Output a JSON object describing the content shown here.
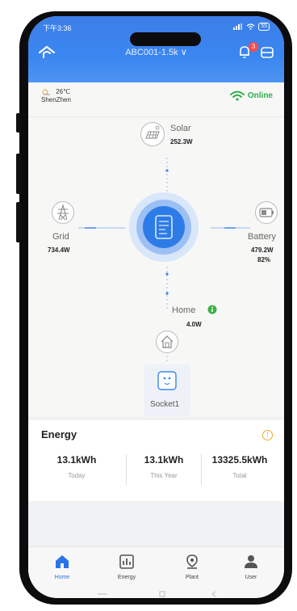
{
  "status_bar": {
    "time": "下午3:36",
    "battery": "55"
  },
  "header": {
    "title": "ABC001-1.5k ∨",
    "notification_count": "3"
  },
  "weather": {
    "temperature": "26℃",
    "city": "ShenZhen"
  },
  "connection": {
    "status": "Online"
  },
  "flow": {
    "solar": {
      "label": "Solar",
      "value": "252.3W"
    },
    "grid": {
      "label": "Grid",
      "value": "734.4W"
    },
    "battery": {
      "label": "Battery",
      "value": "479.2W",
      "percent": "82%"
    },
    "home": {
      "label": "Home",
      "value": "4.0W"
    },
    "socket": {
      "label": "Socket1"
    }
  },
  "energy": {
    "title": "Energy",
    "stats": [
      {
        "value": "13.1kWh",
        "label": "Today"
      },
      {
        "value": "13.1kWh",
        "label": "This Year"
      },
      {
        "value": "13325.5kWh",
        "label": "Total"
      }
    ]
  },
  "tabs": [
    {
      "label": "Home",
      "icon": "home-icon",
      "active": true
    },
    {
      "label": "Energy",
      "icon": "chart-icon",
      "active": false
    },
    {
      "label": "Plant",
      "icon": "location-icon",
      "active": false
    },
    {
      "label": "User",
      "icon": "user-icon",
      "active": false
    }
  ],
  "colors": {
    "accent": "#3a86f0",
    "online": "#2eae4a",
    "warning": "#f3a52b"
  }
}
